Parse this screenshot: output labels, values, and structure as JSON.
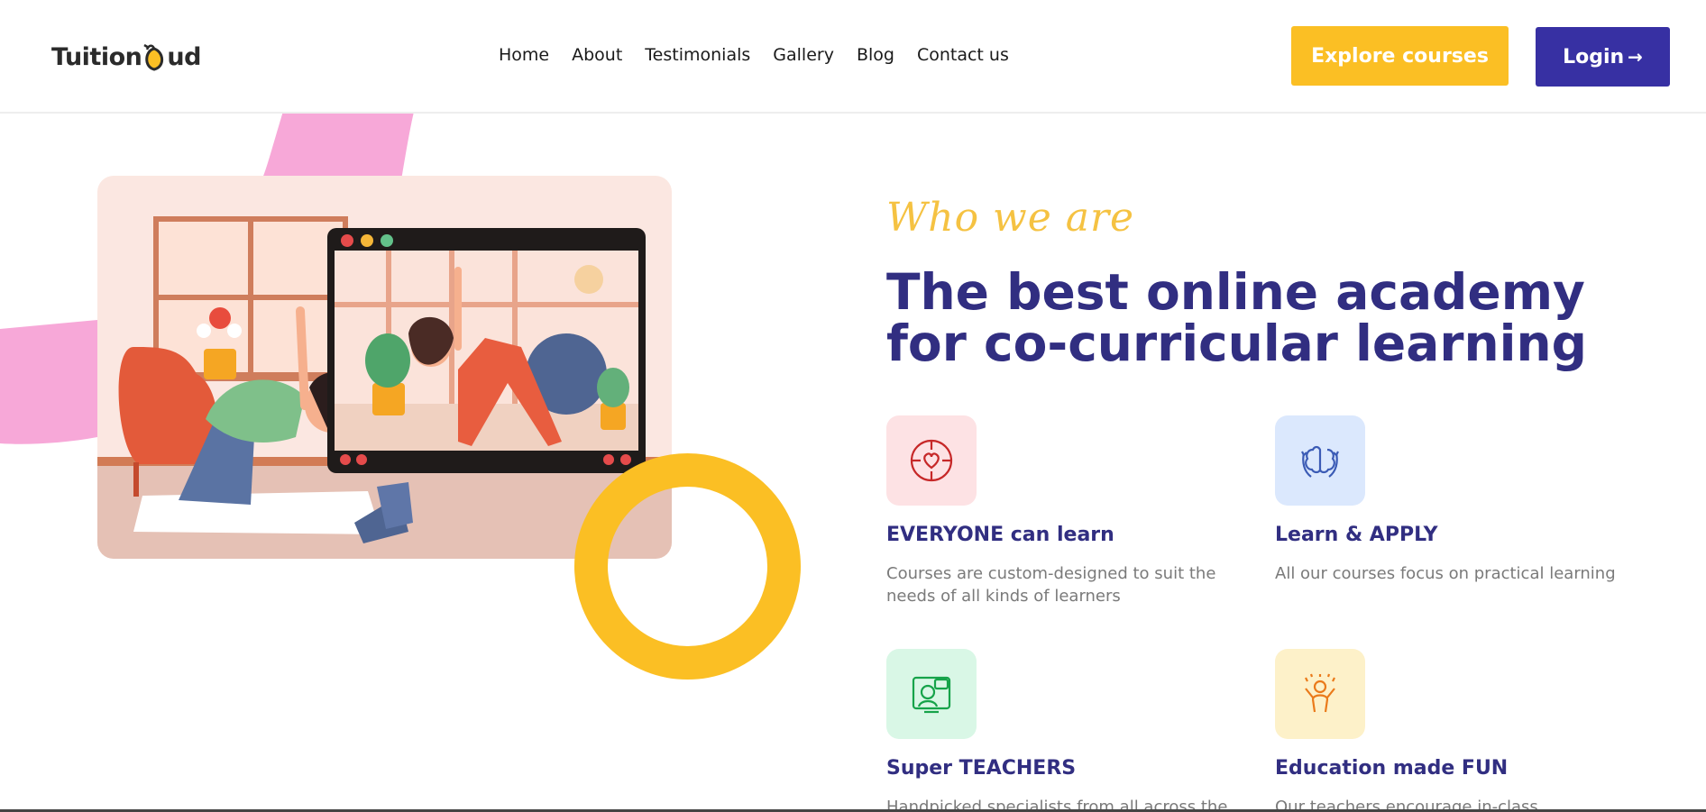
{
  "brand": {
    "name_part1": "Tuition",
    "name_part2": "ud"
  },
  "nav": {
    "items": [
      "Home",
      "About",
      "Testimonials",
      "Gallery",
      "Blog",
      "Contact us"
    ]
  },
  "header": {
    "explore_label": "Explore courses",
    "login_label": "Login",
    "login_arrow": "→"
  },
  "hero": {
    "eyebrow": "Who we are",
    "headline": "The best online academy for co-curricular learning"
  },
  "features": [
    {
      "title": "EVERYONE can learn",
      "desc": "Courses are custom-designed to suit the needs of all kinds of learners",
      "icon": "heart-puzzle-icon",
      "icon_bg": "#fde2e4",
      "icon_color": "#d32f2f"
    },
    {
      "title": "Learn & APPLY",
      "desc": "All our courses focus on practical learning",
      "icon": "brain-cycle-icon",
      "icon_bg": "#dbe8fd",
      "icon_color": "#3b5bb5"
    },
    {
      "title": "Super TEACHERS",
      "desc": "Handpicked specialists from all across the",
      "icon": "teacher-screen-icon",
      "icon_bg": "#d9f7e6",
      "icon_color": "#16a34a"
    },
    {
      "title": "Education made FUN",
      "desc": "Our teachers encourage in-class",
      "icon": "celebrating-person-icon",
      "icon_bg": "#fdf1c9",
      "icon_color": "#ea7a1a"
    }
  ],
  "colors": {
    "accent_yellow": "#fbbf24",
    "brand_indigo": "#312e81",
    "login_bg": "#3730a3",
    "pink": "#f7a8d8"
  }
}
